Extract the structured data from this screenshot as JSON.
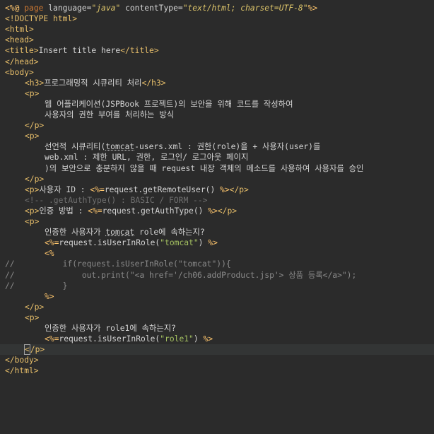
{
  "editor": {
    "lines": [
      {
        "segments": [
          [
            "jsp",
            "<%@ "
          ],
          [
            "kw",
            "page "
          ],
          [
            "txt",
            "language="
          ],
          [
            "strv",
            "\"java\""
          ],
          [
            "txt",
            " contentType="
          ],
          [
            "strv",
            "\"text/html; charset=UTF-8\""
          ],
          [
            "jsp",
            "%>"
          ]
        ]
      },
      {
        "segments": [
          [
            "tag",
            "<!DOCTYPE html>"
          ]
        ]
      },
      {
        "segments": [
          [
            "tag",
            "<html>"
          ]
        ]
      },
      {
        "segments": [
          [
            "tag",
            "<head>"
          ]
        ]
      },
      {
        "segments": [
          [
            "tag",
            "<title>"
          ],
          [
            "txt",
            "Insert title here"
          ],
          [
            "tag",
            "</title>"
          ]
        ]
      },
      {
        "segments": [
          [
            "tag",
            "</head>"
          ]
        ]
      },
      {
        "segments": [
          [
            "tag",
            "<body>"
          ]
        ]
      },
      {
        "indent": "ind1",
        "segments": [
          [
            "tag",
            "<h3>"
          ],
          [
            "txt",
            "프로그래밍적 시큐리티 처리"
          ],
          [
            "tag",
            "</h3>"
          ]
        ]
      },
      {
        "indent": "ind1",
        "segments": [
          [
            "tag",
            "<p>"
          ]
        ]
      },
      {
        "indent": "ind2",
        "segments": [
          [
            "txt",
            "웹 어플리케이션(JSPBook 프로젝트)의 보안을 위해 코드를 작성하여"
          ]
        ]
      },
      {
        "indent": "ind2",
        "segments": [
          [
            "txt",
            "사용자의 권한 부여를 처리하는 방식"
          ]
        ]
      },
      {
        "indent": "ind1",
        "segments": [
          [
            "tag",
            "</p>"
          ]
        ]
      },
      {
        "indent": "ind1",
        "segments": [
          [
            "tag",
            "<p>"
          ]
        ]
      },
      {
        "indent": "ind2",
        "segments": [
          [
            "txt",
            "선언적 시큐리티("
          ],
          [
            "spell",
            "tomcat"
          ],
          [
            "txt",
            "-users.xml : 권한(role)을 + 사용자(user)를"
          ]
        ]
      },
      {
        "indent": "ind2",
        "segments": [
          [
            "txt",
            "web.xml : 제한 URL, 권한, 로그인/ 로그아웃 페이지"
          ]
        ]
      },
      {
        "indent": "ind2",
        "segments": [
          [
            "txt",
            ")의 보안으로 충분하지 않을 때 request 내장 객체의 메소드를 사용하여 사용자를 승인"
          ]
        ]
      },
      {
        "indent": "ind1",
        "segments": [
          [
            "tag",
            "</p>"
          ]
        ]
      },
      {
        "indent": "ind1",
        "segments": [
          [
            "tag",
            "<p>"
          ],
          [
            "txt",
            "사용자 ID : "
          ],
          [
            "jsp",
            "<%="
          ],
          [
            "code",
            "request.getRemoteUser() "
          ],
          [
            "jsp",
            "%>"
          ],
          [
            "tag",
            "</p>"
          ]
        ]
      },
      {
        "indent": "ind1",
        "segments": [
          [
            "cmt",
            "<!-- .getAuthType() : BASIC / FORM -->"
          ]
        ]
      },
      {
        "indent": "ind1",
        "segments": [
          [
            "tag",
            "<p>"
          ],
          [
            "txt",
            "인증 방법 : "
          ],
          [
            "jsp",
            "<%="
          ],
          [
            "code",
            "request.getAuthType() "
          ],
          [
            "jsp",
            "%>"
          ],
          [
            "tag",
            "</p>"
          ]
        ]
      },
      {
        "indent": "ind1",
        "segments": [
          [
            "tag",
            "<p>"
          ]
        ]
      },
      {
        "indent": "ind2",
        "segments": [
          [
            "txt",
            "인증한 사용자가 "
          ],
          [
            "spell",
            "tomcat"
          ],
          [
            "txt",
            " role에 속하는지?"
          ]
        ]
      },
      {
        "indent": "ind2",
        "segments": [
          [
            "jsp",
            "<%="
          ],
          [
            "code",
            "request.isUserInRole("
          ],
          [
            "str",
            "\"tomcat\""
          ],
          [
            "code",
            ") "
          ],
          [
            "jsp",
            "%>"
          ]
        ]
      },
      {
        "indent": "ind2",
        "segments": [
          [
            "jsp",
            "<%"
          ]
        ]
      },
      {
        "segments": [
          [
            "dim",
            "//          if(request.isUserInRole("
          ],
          [
            "dim",
            "\"tomcat\""
          ],
          [
            "dim",
            ")){"
          ]
        ]
      },
      {
        "segments": [
          [
            "dim",
            "//              out.print("
          ],
          [
            "dim",
            "\"<a href='/ch06.addProduct.jsp'> 상품 등록</a>\""
          ],
          [
            "dim",
            ");"
          ]
        ]
      },
      {
        "segments": [
          [
            "dim",
            "//          }"
          ]
        ]
      },
      {
        "indent": "ind2",
        "segments": [
          [
            "jsp",
            "%>"
          ]
        ]
      },
      {
        "indent": "ind1",
        "segments": [
          [
            "tag",
            "</p>"
          ]
        ]
      },
      {
        "indent": "ind1",
        "segments": [
          [
            "tag",
            "<p>"
          ]
        ]
      },
      {
        "indent": "ind2",
        "segments": [
          [
            "txt",
            "인증한 사용자가 role1에 속하는지?"
          ]
        ]
      },
      {
        "indent": "ind2",
        "segments": [
          [
            "jsp",
            "<%="
          ],
          [
            "code",
            "request.isUserInRole("
          ],
          [
            "str",
            "\"role1\""
          ],
          [
            "code",
            ") "
          ],
          [
            "jsp",
            "%>"
          ]
        ]
      },
      {
        "indent": "ind1",
        "current": true,
        "segments": [
          [
            "cursor",
            "<"
          ],
          [
            "tag",
            "/p>"
          ]
        ]
      },
      {
        "segments": [
          [
            "tag",
            "</body>"
          ]
        ]
      },
      {
        "segments": [
          [
            "tag",
            "</html>"
          ]
        ]
      }
    ]
  }
}
